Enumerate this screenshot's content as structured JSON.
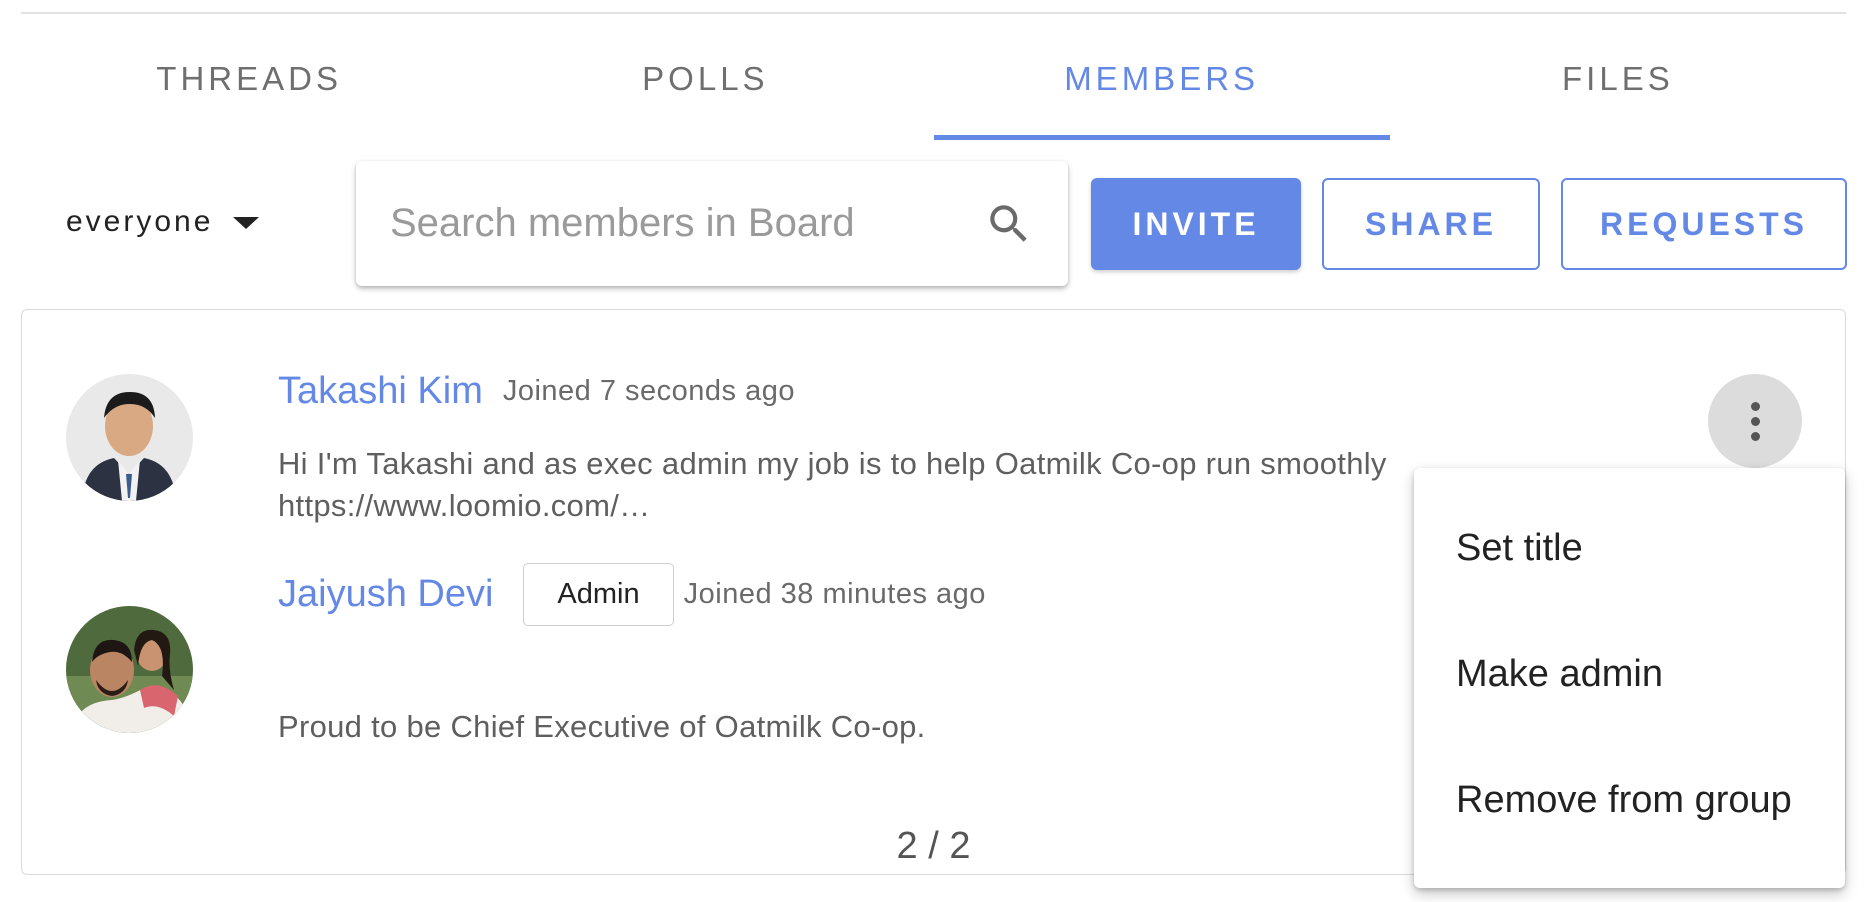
{
  "tabs": [
    {
      "label": "THREADS"
    },
    {
      "label": "POLLS"
    },
    {
      "label": "MEMBERS",
      "active": true
    },
    {
      "label": "FILES"
    }
  ],
  "filter": {
    "selected": "everyone"
  },
  "search": {
    "placeholder": "Search members in Board",
    "value": ""
  },
  "actions": {
    "invite": "INVITE",
    "share": "SHARE",
    "requests": "REQUESTS"
  },
  "members": [
    {
      "name": "Takashi Kim",
      "badge": "",
      "joined": "Joined 7 seconds ago",
      "bio_line1": "Hi I'm Takashi and as exec admin my job is to help Oatmilk Co-op run smoothly",
      "bio_line2": "https://www.loomio.com/…"
    },
    {
      "name": "Jaiyush Devi",
      "badge": "Admin",
      "joined": "Joined 38 minutes ago",
      "bio_line1": "Proud to be Chief Executive of Oatmilk Co-op."
    }
  ],
  "pagination": "2 / 2",
  "context_menu": {
    "items": [
      "Set title",
      "Make admin",
      "Remove from group"
    ]
  },
  "colors": {
    "accent": "#6488e6",
    "text_muted": "#6a6a6a",
    "menu_button_bg": "#dcdcdc"
  }
}
